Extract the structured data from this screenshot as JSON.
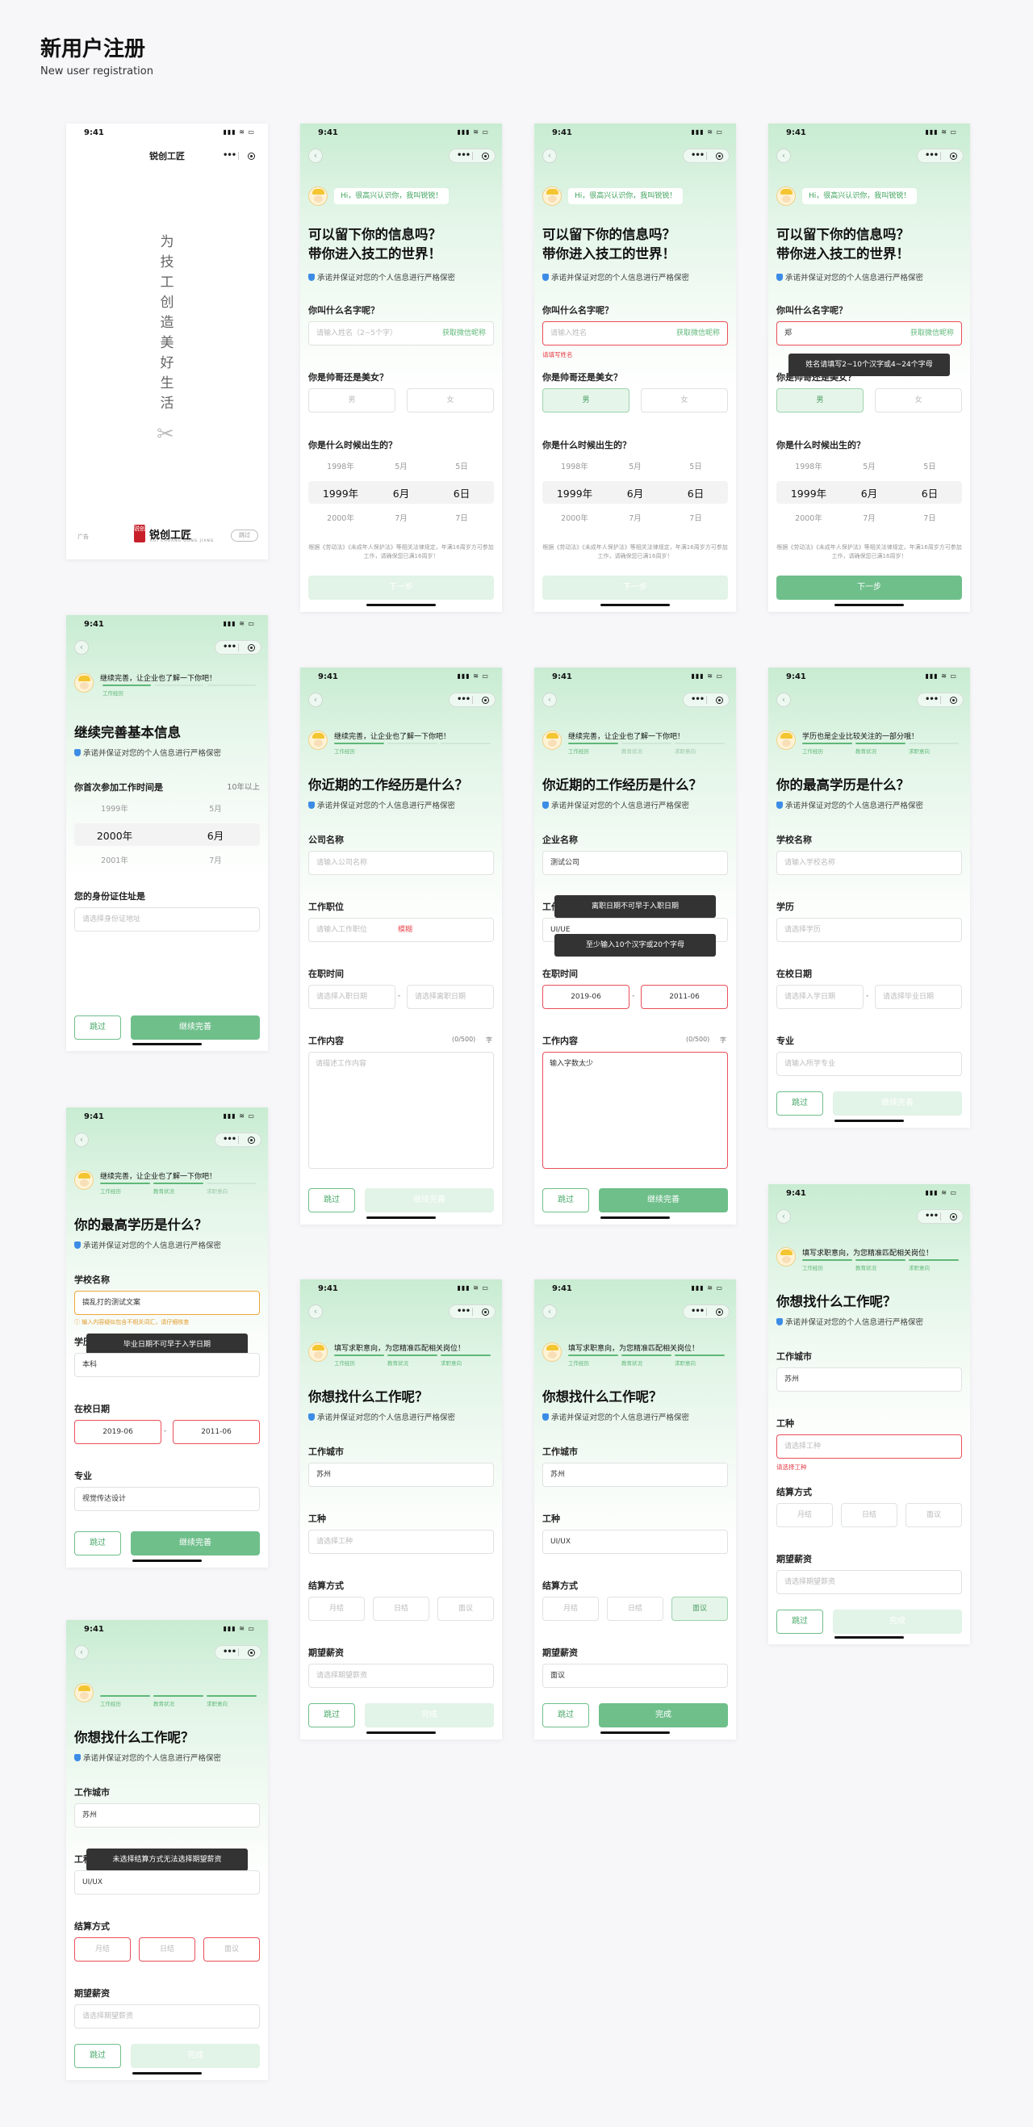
{
  "header": {
    "title": "新用户注册",
    "subtitle": "New user registration"
  },
  "status": {
    "time": "9:41",
    "icons": "▮▮▮ ≋ ▭"
  },
  "capsule": {
    "dots": "•••"
  },
  "splash": {
    "nav_title": "锐创工匠",
    "poem": [
      "为",
      "技",
      "工",
      "创",
      "造",
      "美",
      "好",
      "生",
      "活"
    ],
    "ad": "广告",
    "skip": "跳过",
    "seal": "锐创工匠",
    "brand": "锐创工匠",
    "brand_en": "RUI CHUANG GONG JIANG"
  },
  "step1": {
    "greet": "Hi，很高兴认识你，我叫锐锐！",
    "title1": "可以留下你的信息吗？",
    "title2": "带你进入技工的世界！",
    "promise": "承诺并保证对您的个人信息进行严格保密",
    "q_name": "你叫什么名字呢？",
    "name_ph": "请输入姓名（2~5个字）",
    "name_ph2": "请输入姓名",
    "get_wechat": "获取微信昵称",
    "name_err": "请填写姓名",
    "name_val": "郑",
    "name_tip": "姓名请填写2~10个汉字或4~24个字母",
    "q_gender": "你是帅哥还是美女？",
    "male": "男",
    "female": "女",
    "q_birth": "你是什么时候出生的？",
    "years": [
      "1998年",
      "1999年",
      "2000年"
    ],
    "months": [
      "5月",
      "6月",
      "7月"
    ],
    "days": [
      "5日",
      "6日",
      "7日"
    ],
    "note": "根据《劳动法》《未成年人保护法》等相关法律规定，年满16周岁方可参加工作，请确保您已满16周岁！",
    "next": "下一步"
  },
  "basic": {
    "progress": "继续完善，让企业也了解一下你吧！",
    "p1": "工作经历",
    "p2": "教育状况",
    "p3": "求职意向",
    "title": "继续完善基本信息",
    "q_time": "你首次参加工作时间是",
    "q_time_r": "10年以上",
    "years": [
      "1999年",
      "2000年",
      "2001年"
    ],
    "months": [
      "5月",
      "6月",
      "7月"
    ],
    "q_id": "您的身份证住址是",
    "id_ph": "请选择身份证地址",
    "skip": "跳过",
    "done": "继续完善"
  },
  "work": {
    "title": "你近期的工作经历是什么？",
    "l_company": "公司名称",
    "l_company2": "企业名称",
    "company_ph": "请输入公司名称",
    "company_val": "测试公司",
    "l_position": "工作职位",
    "position_ph": "请输入工作职位",
    "position_err": "模糊",
    "position_val": "UI/UE",
    "l_time": "在职时间",
    "start_ph": "请选择入职日期",
    "end_ph": "请选择离职日期",
    "start_val": "2019-06",
    "end_val": "2011-06",
    "dash": "-",
    "l_content": "工作内容",
    "count": "(0/500)",
    "count_icon": "字",
    "content_ph": "请描述工作内容",
    "content_val": "输入字数太少",
    "tip_date": "离职日期不可早于入职日期",
    "tip_len": "至少输入10个汉字或20个字母"
  },
  "edu": {
    "progress": "学历也是企业比较关注的一部分哦！",
    "title": "你的最高学历是什么？",
    "l_school": "学校名称",
    "school_ph": "请输入学校名称",
    "school_val": "搞乱打的测试文案",
    "school_warn": "输入内容疑似包含不相关词汇，请仔细核查",
    "l_degree": "学历",
    "degree_ph": "请选择学历",
    "degree_val": "本科",
    "l_date": "在校日期",
    "start_ph": "请选择入学日期",
    "end_ph": "请选择毕业日期",
    "start_val": "2019-06",
    "end_val": "2011-06",
    "tip": "毕业日期不可早于入学日期",
    "l_major": "专业",
    "major_ph": "请输入所学专业",
    "major_val": "视觉传达设计"
  },
  "job": {
    "progress": "填写求职意向，为您精准匹配相关岗位！",
    "title": "你想找什么工作呢？",
    "l_city": "工作城市",
    "city_val": "苏州",
    "l_type": "工种",
    "type_ph": "请选择工种",
    "type_val": "UI/UX",
    "type_err": "请选择工种",
    "l_pay": "结算方式",
    "pay": [
      "月结",
      "日结",
      "面议"
    ],
    "l_salary": "期望薪资",
    "salary_ph": "请选择期望薪资",
    "salary_val": "面议",
    "tip": "未选择结算方式无法选择期望薪资",
    "finish": "完成"
  }
}
